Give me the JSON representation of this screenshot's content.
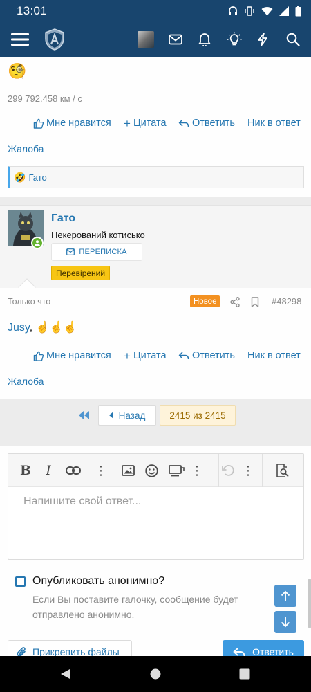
{
  "status_bar": {
    "time": "13:01"
  },
  "post_prev": {
    "emoji": "🧐",
    "signature": "299 792.458 км / с",
    "actions": {
      "like": "Мне нравится",
      "quote": "Цитата",
      "reply": "Ответить",
      "mention": "Ник в ответ"
    },
    "report": "Жалоба",
    "reaction_user": "Гато"
  },
  "post": {
    "username": "Гато",
    "user_title": "Некерований котисько",
    "pm_label": "ПЕРЕПИСКА",
    "badge": "Перевірений",
    "time": "Только что",
    "new_badge": "Новое",
    "post_number": "#48298",
    "mention": "Jusy",
    "body_rest": ", ☝️☝️☝️",
    "actions": {
      "like": "Мне нравится",
      "quote": "Цитата",
      "reply": "Ответить",
      "mention": "Ник в ответ"
    },
    "report": "Жалоба"
  },
  "pagination": {
    "back": "Назад",
    "current": "2415 из 2415"
  },
  "editor": {
    "placeholder": "Напишите свой ответ..."
  },
  "anonymous": {
    "label": "Опубликовать анонимно?",
    "hint": "Если Вы поставите галочку, сообщение будет отправлено анонимно."
  },
  "buttons": {
    "attach": "Прикрепить файлы",
    "submit": "Ответить"
  },
  "colors": {
    "header": "#18456e",
    "link": "#2577b1",
    "accent": "#3c9ae0",
    "new_badge": "#f39121",
    "verified": "#f7c513",
    "online": "#63b32e"
  }
}
